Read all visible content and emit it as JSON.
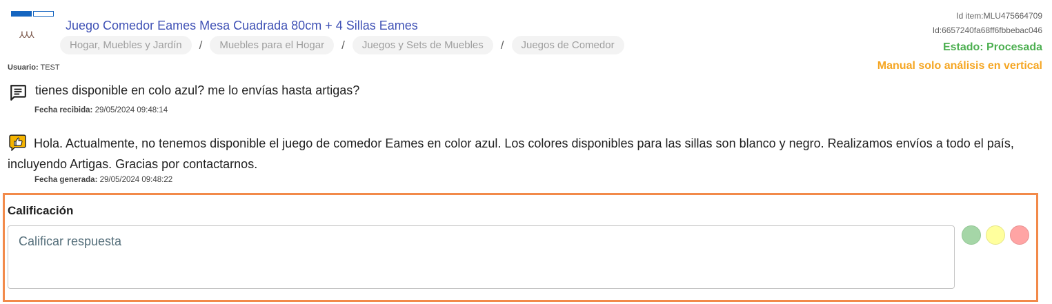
{
  "header": {
    "title": "Juego Comedor Eames Mesa Cuadrada 80cm + 4 Sillas Eames",
    "breadcrumbs": [
      "Hogar, Muebles y Jardín",
      "Muebles para el Hogar",
      "Juegos y Sets de Muebles",
      "Juegos de Comedor"
    ],
    "breadcrumb_separator": "/",
    "id_item": "Id item:MLU475664709",
    "id_sub": "Id:6657240fa68ff6fbbebac046",
    "estado": "Estado: Procesada",
    "manual_note": "Manual solo análisis en vertical"
  },
  "user": {
    "label": "Usuario:",
    "value": "TEST"
  },
  "question": {
    "icon": "chat-message-icon",
    "text": "tienes disponible en colo azul? me lo envías hasta artigas?",
    "date_label": "Fecha recibida:",
    "date_value": "29/05/2024 09:48:14"
  },
  "answer": {
    "icon": "thumbs-up-bubble-icon",
    "text": "Hola. Actualmente, no tenemos disponible el juego de comedor Eames en color azul. Los colores disponibles para las sillas son blanco y negro. Realizamos envíos a todo el país, incluyendo Artigas. Gracias por contactarnos.",
    "date_label": "Fecha generada:",
    "date_value": "29/05/2024 09:48:22"
  },
  "rating": {
    "title": "Calificación",
    "placeholder": "Calificar respuesta",
    "value": "",
    "options": [
      {
        "name": "green",
        "color": "#a5d6a7"
      },
      {
        "name": "yellow",
        "color": "#ffff9d"
      },
      {
        "name": "red",
        "color": "#ffa4a4"
      }
    ]
  },
  "colors": {
    "title": "#3f51b5",
    "estado": "#4caf50",
    "manual": "#f5a623",
    "panel_border": "#f28a4a",
    "icon_bubble": "#f5b400"
  }
}
